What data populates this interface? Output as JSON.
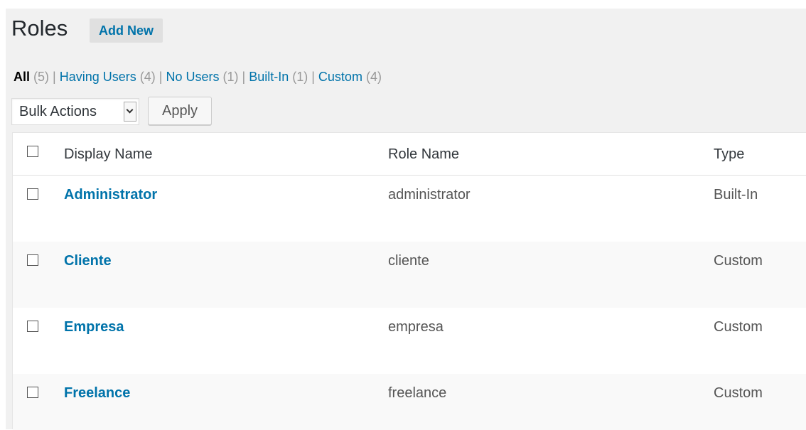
{
  "header": {
    "title": "Roles",
    "add_new_label": "Add New"
  },
  "filters": [
    {
      "label": "All",
      "count": "(5)",
      "current": true
    },
    {
      "label": "Having Users",
      "count": "(4)",
      "current": false
    },
    {
      "label": "No Users",
      "count": "(1)",
      "current": false
    },
    {
      "label": "Built-In",
      "count": "(1)",
      "current": false
    },
    {
      "label": "Custom",
      "count": "(4)",
      "current": false
    }
  ],
  "separator": "|",
  "bulk_actions": {
    "selected": "Bulk Actions",
    "apply_label": "Apply"
  },
  "table": {
    "columns": {
      "display_name": "Display Name",
      "role_name": "Role Name",
      "type": "Type"
    },
    "rows": [
      {
        "display_name": "Administrator",
        "role_name": "administrator",
        "type": "Built-In"
      },
      {
        "display_name": "Cliente",
        "role_name": "cliente",
        "type": "Custom"
      },
      {
        "display_name": "Empresa",
        "role_name": "empresa",
        "type": "Custom"
      },
      {
        "display_name": "Freelance",
        "role_name": "freelance",
        "type": "Custom"
      }
    ]
  },
  "colors": {
    "link": "#0073aa",
    "page_bg": "#f1f1f1",
    "alt_row": "#f9f9f9"
  }
}
